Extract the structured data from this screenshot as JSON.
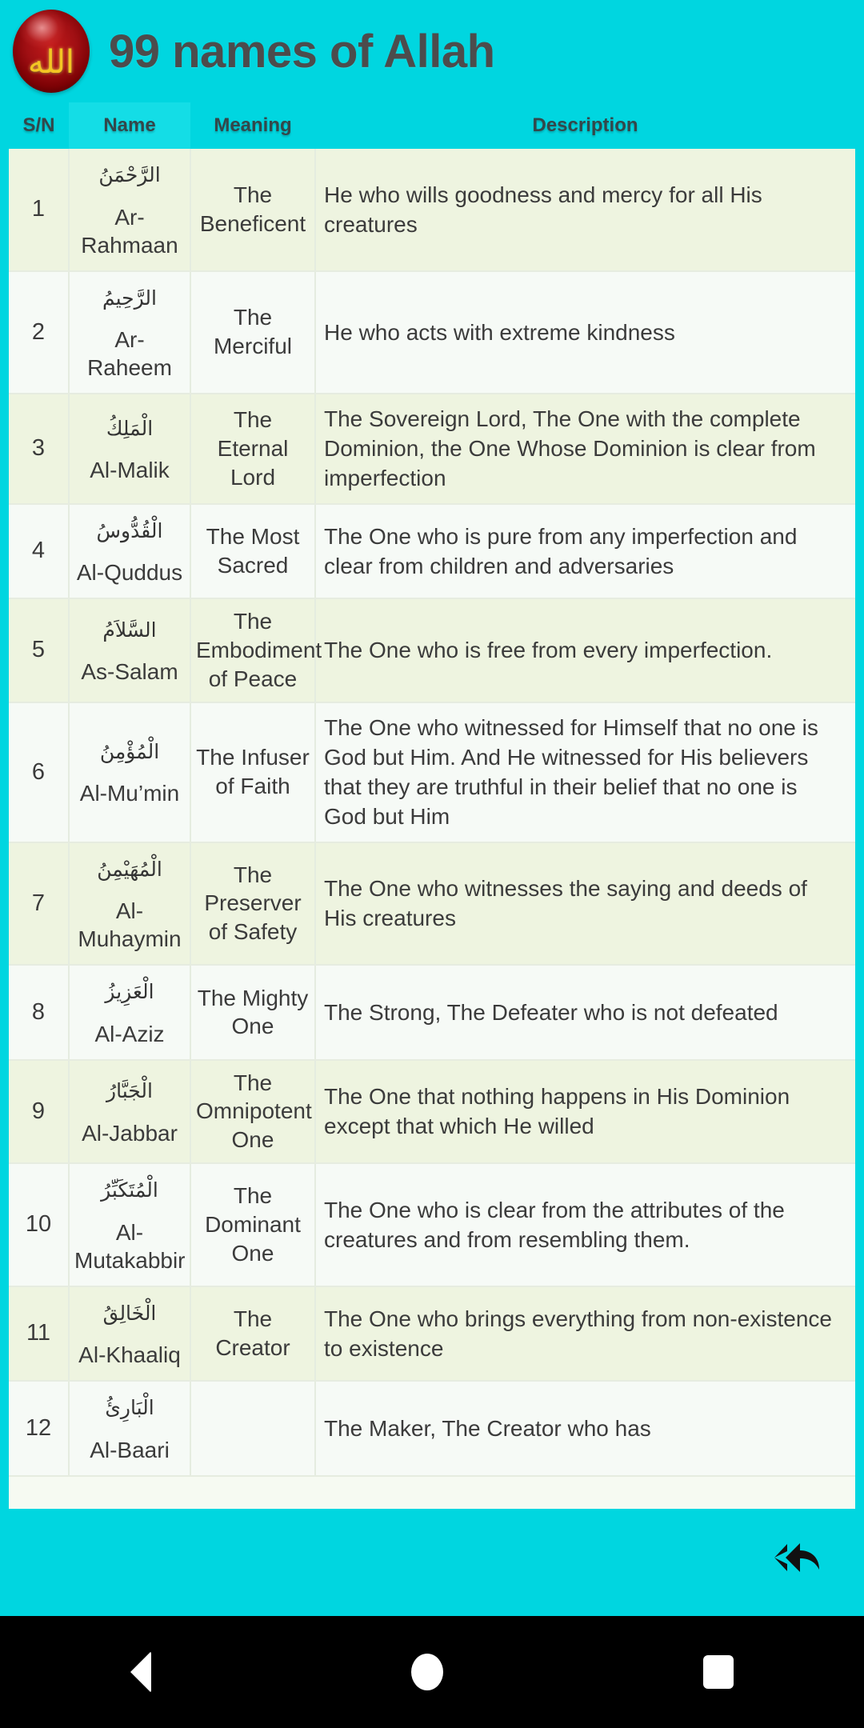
{
  "app": {
    "title": "99 names of Allah",
    "logo_text": "الله",
    "accent_color": "#00d6e0",
    "title_color": "#4c4c4c"
  },
  "table": {
    "headers": {
      "sn": "S/N",
      "name": "Name",
      "meaning": "Meaning",
      "description": "Description"
    },
    "rows": [
      {
        "sn": "1",
        "arabic": "الرَّحْمَنُ",
        "translit": "Ar-Rahmaan",
        "meaning": "The Beneficent",
        "description": "He who wills goodness and mercy for all His creatures"
      },
      {
        "sn": "2",
        "arabic": "الرَّحِيمُ",
        "translit": "Ar-Raheem",
        "meaning": "The Merciful",
        "description": "He who acts with extreme kindness"
      },
      {
        "sn": "3",
        "arabic": "الْمَلِكُ",
        "translit": "Al-Malik",
        "meaning": "The Eternal Lord",
        "description": "The Sovereign Lord, The One with the complete Dominion, the One Whose Dominion is clear from imperfection"
      },
      {
        "sn": "4",
        "arabic": "الْقُدُّوسُ",
        "translit": "Al-Quddus",
        "meaning": "The Most Sacred",
        "description": "The One who is pure from any imperfection and clear from children and adversaries"
      },
      {
        "sn": "5",
        "arabic": "السَّلاَمُ",
        "translit": "As-Salam",
        "meaning": "The Embodiment of Peace",
        "description": "The One who is free from every imperfection."
      },
      {
        "sn": "6",
        "arabic": "الْمُؤْمِنُ",
        "translit": "Al-Mu’min",
        "meaning": "The Infuser of Faith",
        "description": "The One who witnessed for Himself that no one is God but Him. And He witnessed for His believers that they are truthful in their belief that no one is God but Him"
      },
      {
        "sn": "7",
        "arabic": "الْمُهَيْمِنُ",
        "translit": "Al-Muhaymin",
        "meaning": "The Preserver of Safety",
        "description": "The One who witnesses the saying and deeds of His creatures"
      },
      {
        "sn": "8",
        "arabic": "الْعَزِيزُ",
        "translit": "Al-Aziz",
        "meaning": "The Mighty One",
        "description": "The Strong, The Defeater who is not defeated"
      },
      {
        "sn": "9",
        "arabic": "الْجَبَّارُ",
        "translit": "Al-Jabbar",
        "meaning": "The Omnipotent One",
        "description": "The One that nothing happens in His Dominion except that which He willed"
      },
      {
        "sn": "10",
        "arabic": "الْمُتَكَبِّرُ",
        "translit": "Al-Mutakabbir",
        "meaning": "The Dominant One",
        "description": "The One who is clear from the attributes of the creatures and from resembling them."
      },
      {
        "sn": "11",
        "arabic": "الْخَالِقُ",
        "translit": "Al-Khaaliq",
        "meaning": "The Creator",
        "description": "The One who brings everything from non-existence to existence"
      },
      {
        "sn": "12",
        "arabic": "الْبَارِئُ",
        "translit": "Al-Baari",
        "meaning": "",
        "description": "The Maker, The Creator who has"
      }
    ]
  },
  "bottom_bar": {
    "back_icon": "reply-back-icon"
  },
  "system_nav": {
    "back": "nav-back-icon",
    "home": "nav-home-icon",
    "recents": "nav-recents-icon"
  }
}
